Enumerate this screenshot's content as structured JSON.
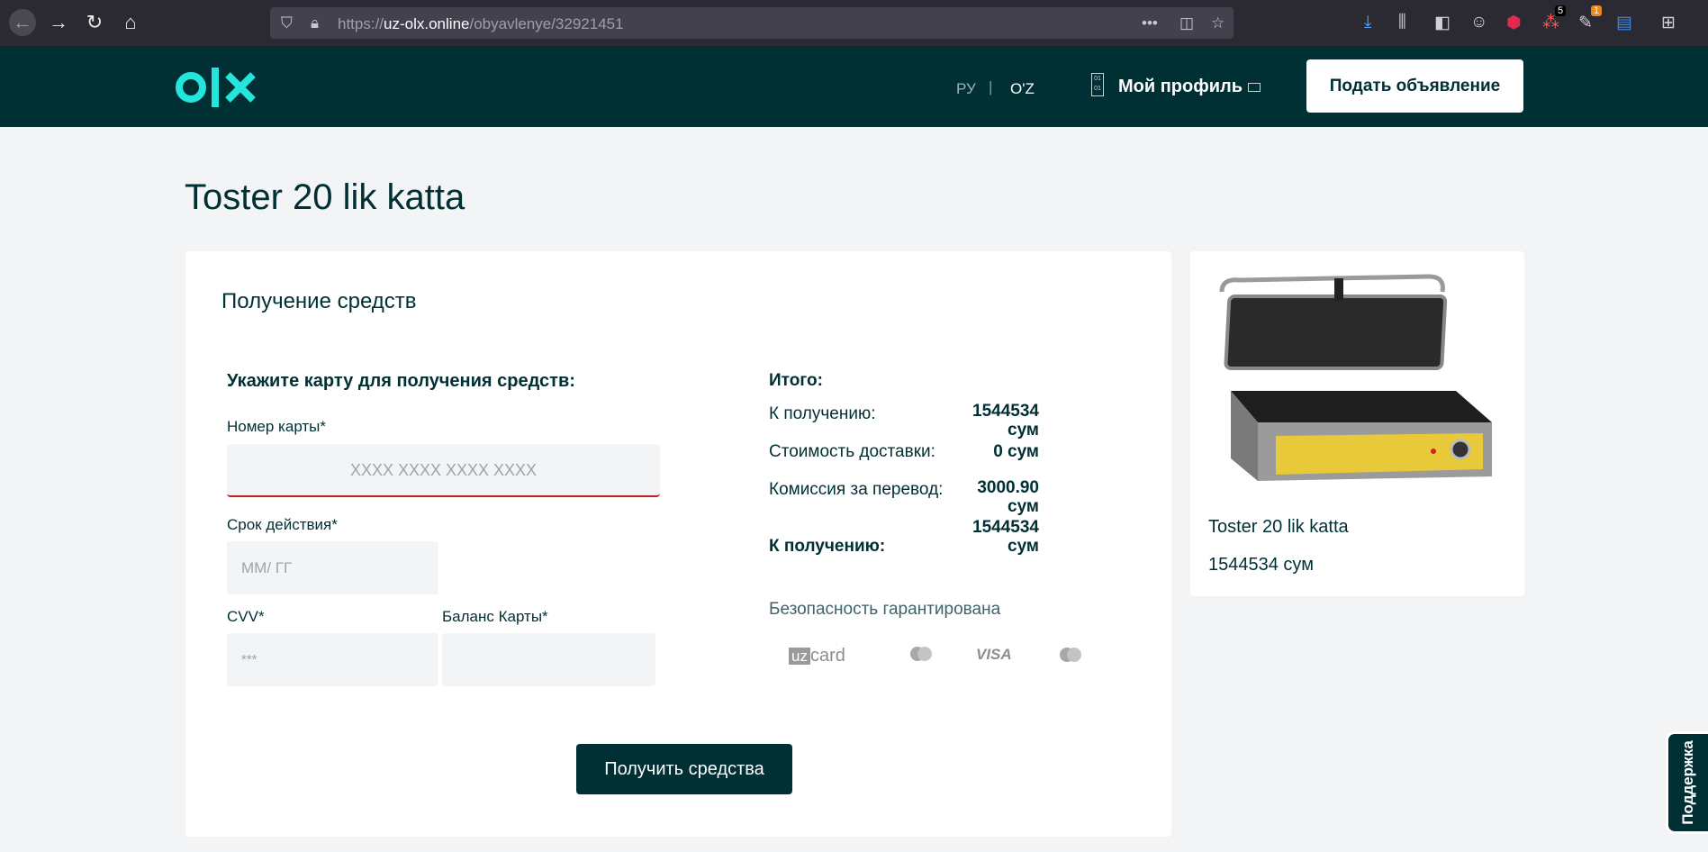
{
  "browser": {
    "url_prefix": "https://",
    "url_domain": "uz-olx.online",
    "url_path": "/obyavlenye/32921451",
    "badge_1": "5",
    "badge_2": "1"
  },
  "header": {
    "lang_ru": "РУ",
    "lang_sep": "|",
    "lang_uz": "O'Z",
    "profile_icon_text": "01 01",
    "profile_label": "Мой профиль",
    "post_button": "Подать объявление"
  },
  "page": {
    "title": "Toster 20 lik katta"
  },
  "form": {
    "card_title": "Получение средств",
    "section_label": "Укажите карту для получения средств:",
    "card_number_label": "Номер карты*",
    "card_number_placeholder": "XXXX XXXX XXXX XXXX",
    "expiry_label": "Срок действия*",
    "expiry_placeholder": "ММ/ ГГ",
    "cvv_label": "CVV*",
    "cvv_placeholder": "***",
    "balance_label": "Баланс Карты*",
    "balance_value": "",
    "submit_button": "Получить средства"
  },
  "totals": {
    "heading": "Итого:",
    "rows": [
      {
        "label": "К получению:",
        "value": "1544534 сум"
      },
      {
        "label": "Стоимость доставки:",
        "value": "0 сум"
      },
      {
        "label": "Комиссия за перевод:",
        "value": "3000.90 сум"
      }
    ],
    "final_label": "К получению:",
    "final_value": "1544534 сум",
    "secure_text": "Безопасность гарантирована",
    "pay_methods": [
      "uz",
      "card",
      "VISA"
    ]
  },
  "product": {
    "title": "Toster 20 lik katta",
    "price": "1544534 сум"
  },
  "support": {
    "label": "Поддержка"
  },
  "colors": {
    "brand_dark": "#002f34",
    "logo_accent": "#23e5db",
    "error_red": "#c51e1e",
    "page_bg": "#f2f4f5"
  }
}
